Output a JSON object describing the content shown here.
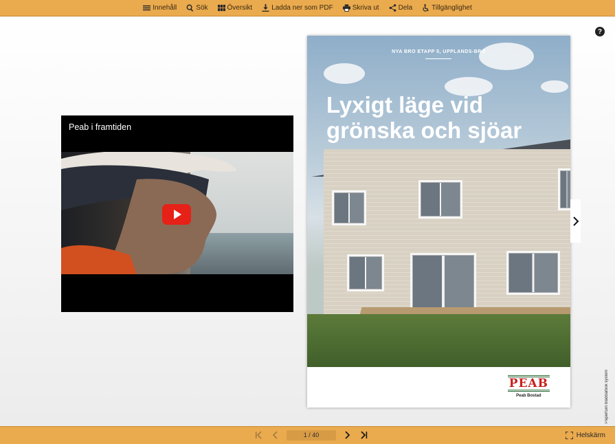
{
  "toolbar": {
    "items": [
      {
        "label": "Innehåll",
        "icon": "list-icon"
      },
      {
        "label": "Sök",
        "icon": "search-icon"
      },
      {
        "label": "Översikt",
        "icon": "grid-icon"
      },
      {
        "label": "Ladda ner som PDF",
        "icon": "download-icon"
      },
      {
        "label": "Skriva ut",
        "icon": "printer-icon"
      },
      {
        "label": "Dela",
        "icon": "share-icon"
      },
      {
        "label": "Tillgänglighet",
        "icon": "accessibility-icon"
      }
    ]
  },
  "help": {
    "label": "?"
  },
  "video": {
    "title": "Peab i framtiden"
  },
  "page": {
    "kicker": "NYA BRO ETAPP 5, UPPLANDS-BRO",
    "headline_line1": "Lyxigt läge vid",
    "headline_line2": "grönska och sjöar",
    "brand_logo": "PEAB",
    "brand_sub": "Peab Bostad"
  },
  "side_credit": "Paperturn bläddarbok system",
  "pagination": {
    "current": 1,
    "total": 40,
    "indicator": "1 / 40"
  },
  "fullscreen": {
    "label": "Helskärm"
  },
  "colors": {
    "bar": "#eaaa4e",
    "play": "#e62117",
    "brand_red": "#c8201e",
    "brand_green": "#2d6b3a"
  }
}
